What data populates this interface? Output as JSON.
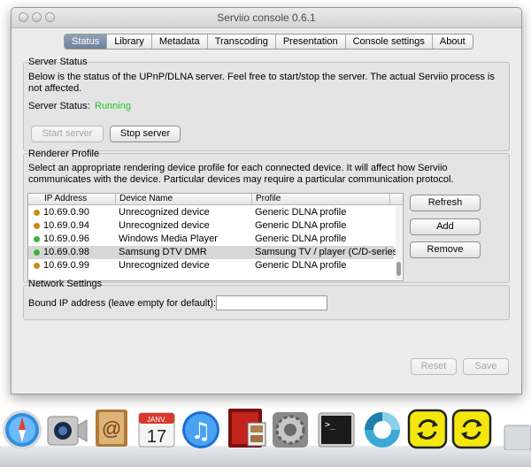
{
  "window": {
    "title": "Serviio console 0.6.1"
  },
  "tabs": [
    {
      "label": "Status",
      "active": true
    },
    {
      "label": "Library"
    },
    {
      "label": "Metadata"
    },
    {
      "label": "Transcoding"
    },
    {
      "label": "Presentation"
    },
    {
      "label": "Console settings"
    },
    {
      "label": "About"
    }
  ],
  "server_status": {
    "title": "Server Status",
    "description_line1": "Below is the status of the UPnP/DLNA server. Feel free to start/stop the server. The actual Serviio process is",
    "description_line2": "not affected.",
    "status_label": "Server Status:",
    "status_value": "Running",
    "status_color": "#21c521",
    "start_label": "Start server",
    "stop_label": "Stop server"
  },
  "renderer_profile": {
    "title": "Renderer Profile",
    "description_line1": "Select an appropriate rendering device profile for each connected device. It will affect how Serviio",
    "description_line2": "communicates with the device. Particular devices may require a particular communication protocol.",
    "columns": [
      "IP Address",
      "Device Name",
      "Profile"
    ],
    "rows": [
      {
        "ip": "10.69.0.90",
        "device": "Unrecognized device",
        "profile": "Generic DLNA profile",
        "status_color": "#c98a1c"
      },
      {
        "ip": "10.69.0.94",
        "device": "Unrecognized device",
        "profile": "Generic DLNA profile",
        "status_color": "#c98a1c"
      },
      {
        "ip": "10.69.0.96",
        "device": "Windows Media Player",
        "profile": "Generic DLNA profile",
        "status_color": "#3cb43c"
      },
      {
        "ip": "10.69.0.98",
        "device": "Samsung DTV DMR",
        "profile": "Samsung TV / player (C/D-series)",
        "status_color": "#3cb43c",
        "selected": true
      },
      {
        "ip": "10.69.0.99",
        "device": "Unrecognized device",
        "profile": "Generic DLNA profile",
        "status_color": "#c98a1c"
      }
    ],
    "refresh_label": "Refresh",
    "add_label": "Add",
    "remove_label": "Remove"
  },
  "network_settings": {
    "title": "Network Settings",
    "bound_ip_label": "Bound IP address (leave empty for default):",
    "bound_ip_value": ""
  },
  "footer": {
    "reset_label": "Reset",
    "save_label": "Save"
  },
  "dock": {
    "calendar_month": "JANV.",
    "calendar_day": "17",
    "items": [
      "safari-icon",
      "facetime-icon",
      "address-book-icon",
      "calendar-icon",
      "itunes-icon",
      "photo-booth-icon",
      "system-preferences-icon",
      "terminal-icon",
      "app-icon",
      "serviio-icon",
      "serviio-icon"
    ]
  }
}
